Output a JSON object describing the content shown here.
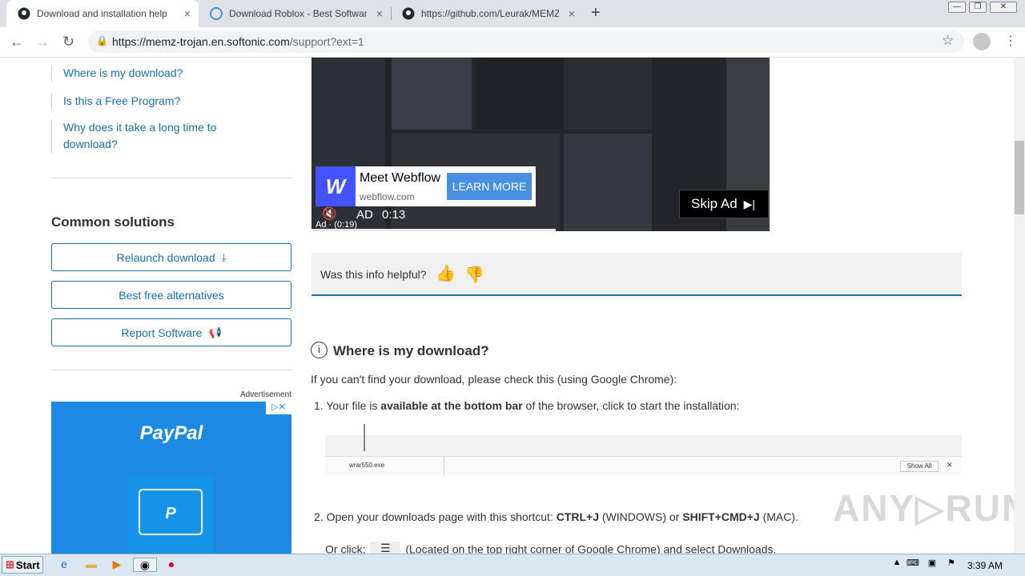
{
  "tabs": [
    {
      "title": "Download and installation help",
      "close": "×"
    },
    {
      "title": "Download Roblox - Best Software &",
      "close": "×"
    },
    {
      "title": "https://github.com/Leurak/MEMZ/ar",
      "close": "×"
    }
  ],
  "new_tab": "+",
  "window_controls": [
    "—",
    "❐",
    "✕"
  ],
  "address": {
    "host": "https://memz-trojan.en.softonic.com",
    "path": "/support?ext=1"
  },
  "sidebar": {
    "links": [
      "Where is my download?",
      "Is this a Free Program?",
      "Why does it take a long time to download?"
    ],
    "common_title": "Common solutions",
    "buttons": [
      "Relaunch download",
      "Best free alternatives",
      "Report Software"
    ]
  },
  "ad_label": "Advertisement",
  "paypal": {
    "brand": "PayPal",
    "ad_icons": "▷✕"
  },
  "video_ad": {
    "title": "Meet Webflow",
    "domain": "webflow.com",
    "cta": "LEARN MORE",
    "logo": "W",
    "ad_text": "AD",
    "timer": "0:13",
    "remaining": "Ad · (0:19)",
    "skip": "Skip Ad"
  },
  "helpful": {
    "question": "Was this info helpful?"
  },
  "section": {
    "title": "Where is my download?",
    "intro": "If you can't find your download, please check this (using Google Chrome):",
    "step1_pre": "1. Your file is ",
    "step1_bold": "available at the bottom bar",
    "step1_post": " of the browser, click to start the installation:",
    "dl_file": "wrar550.exe",
    "dl_showall": "Show All",
    "dl_close": "✕",
    "step2_pre": "2. Open your downloads page with this shortcut: ",
    "step2_key1": "CTRL+J",
    "step2_mid": " (WINDOWS) or ",
    "step2_key2": "SHIFT+CMD+J",
    "step2_post": " (MAC).",
    "step3_pre": "Or click:",
    "step3_post": "(Located on the top right corner of Google Chrome) and select Downloads."
  },
  "watermark": "ANY▷RUN",
  "taskbar": {
    "start": "Start",
    "time": "3:39 AM"
  }
}
